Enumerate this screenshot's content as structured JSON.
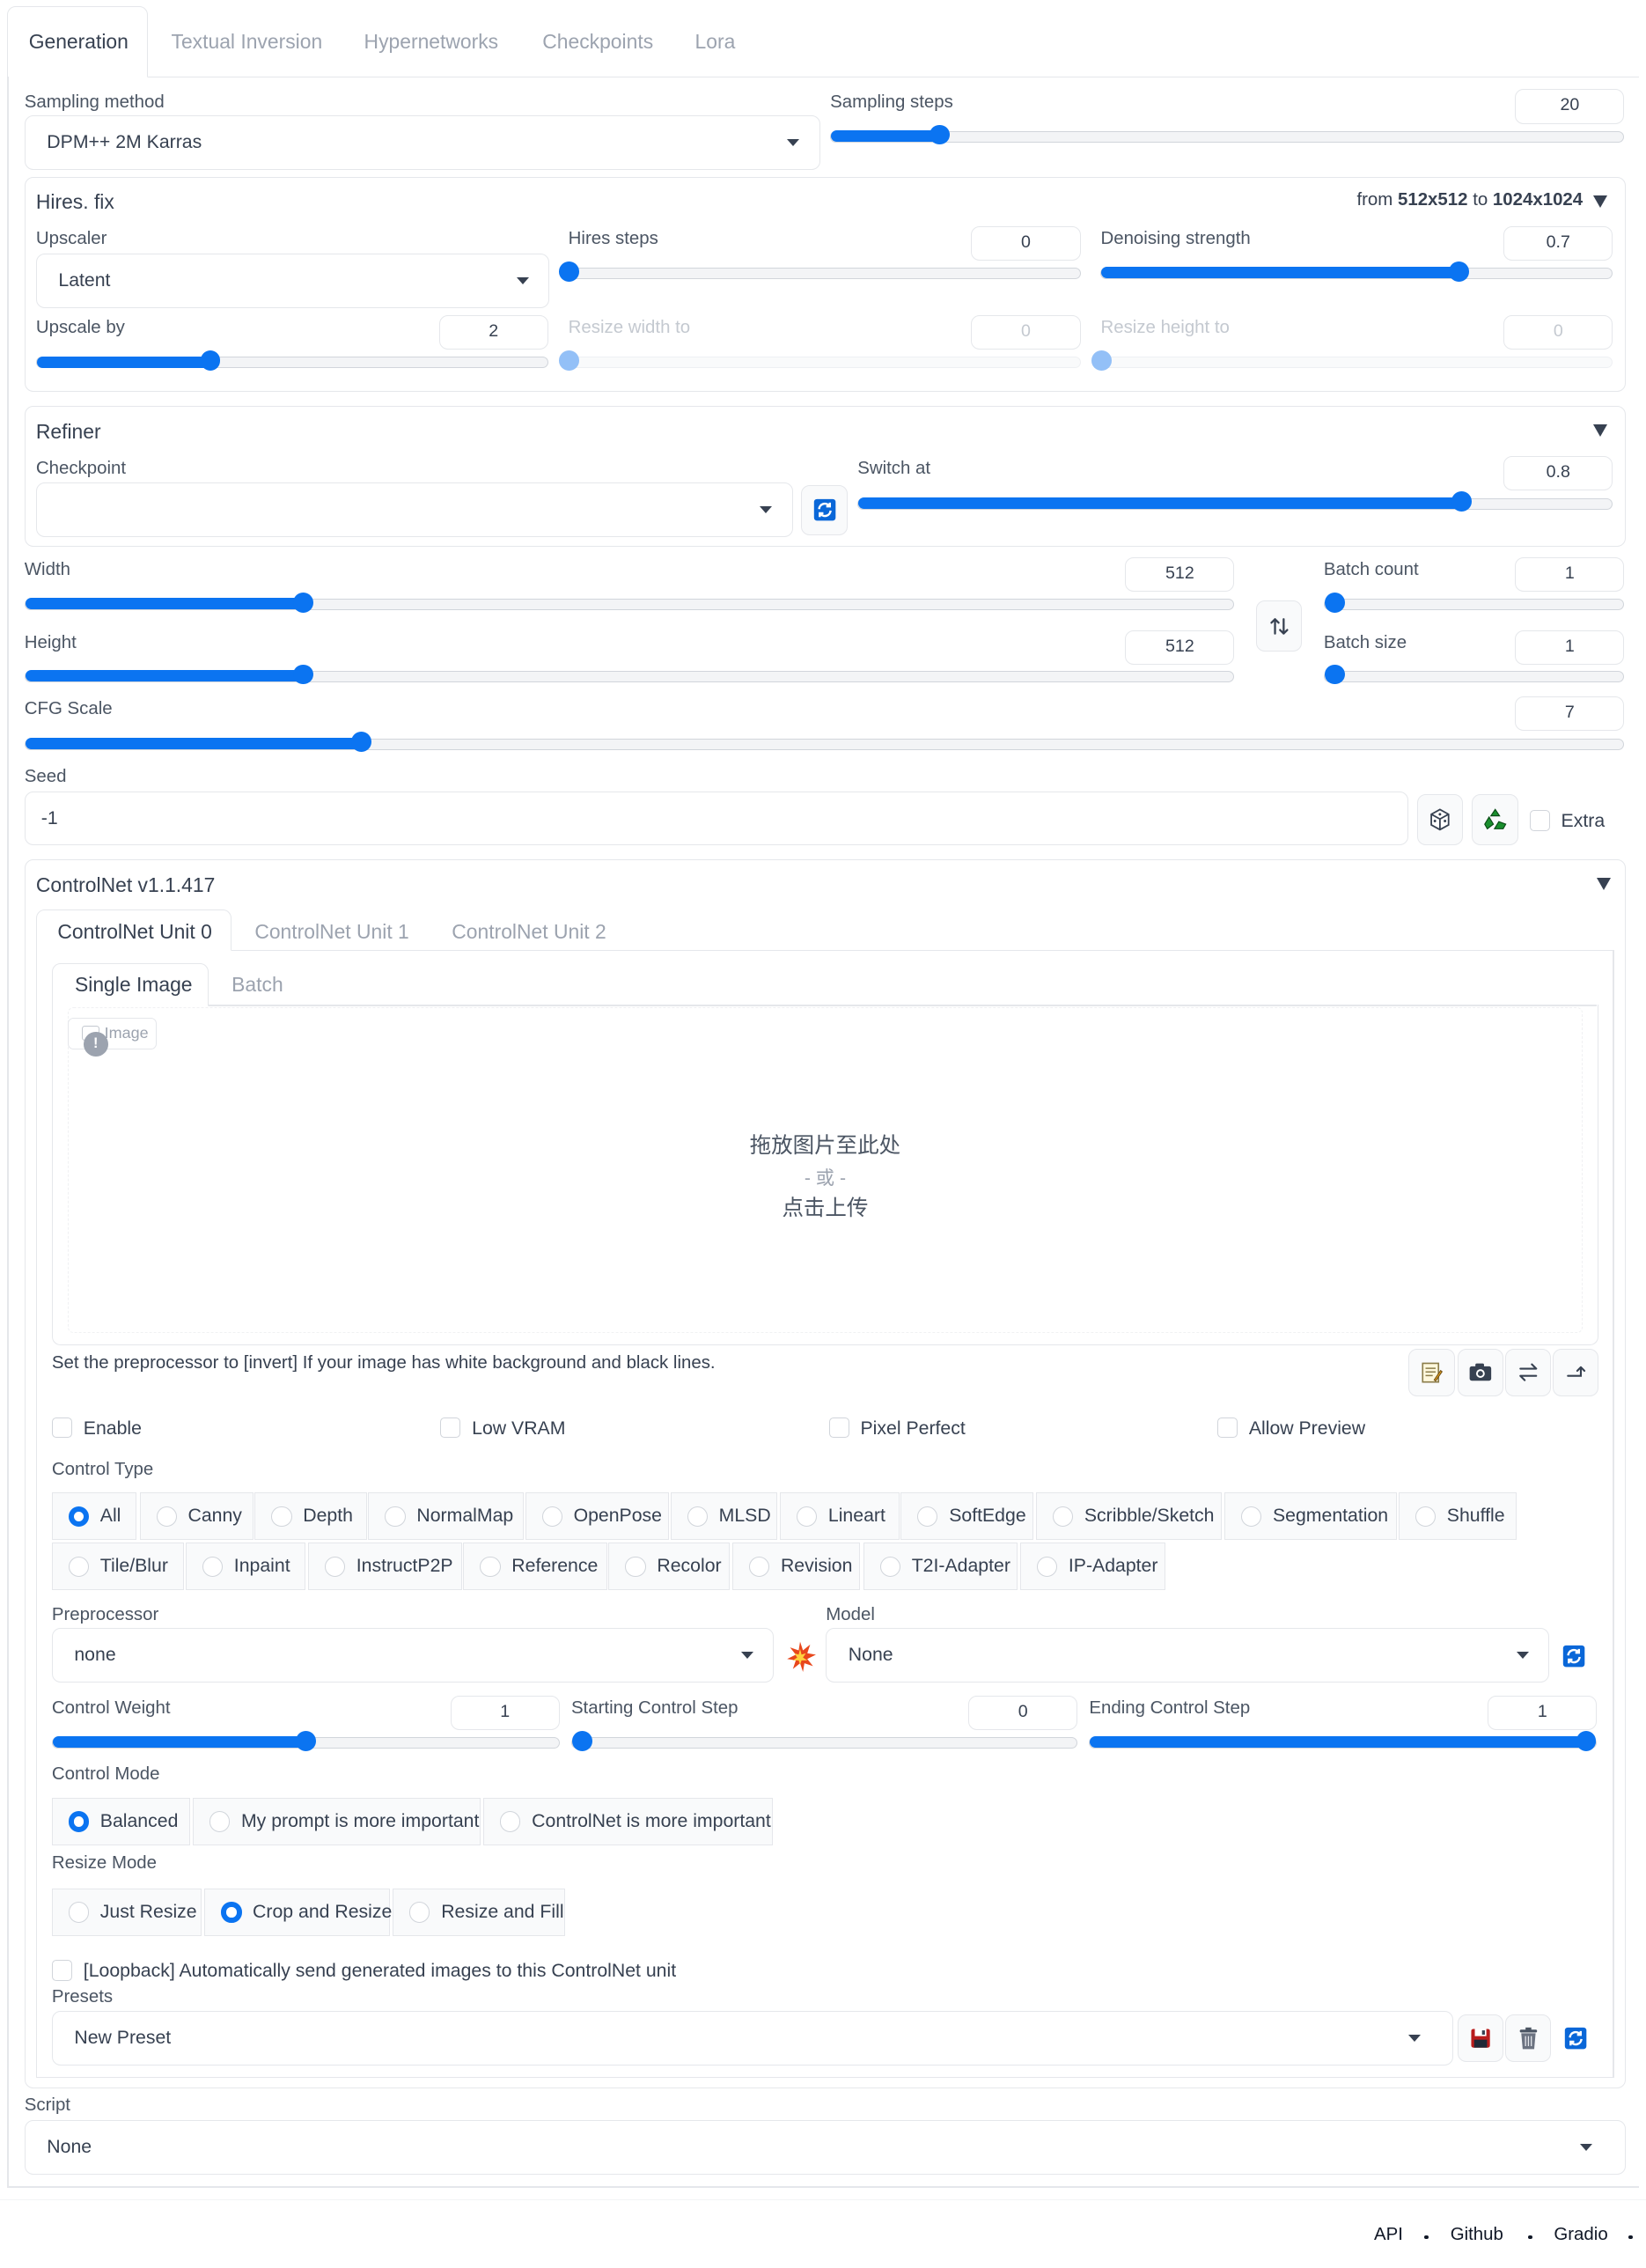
{
  "tabs": [
    "Generation",
    "Textual Inversion",
    "Hypernetworks",
    "Checkpoints",
    "Lora"
  ],
  "sampling_method": {
    "label": "Sampling method",
    "value": "DPM++ 2M Karras"
  },
  "sampling_steps": {
    "label": "Sampling steps",
    "value": "20",
    "fraction": 0.137
  },
  "hires": {
    "title": "Hires. fix",
    "from_word": "from",
    "from_res": "512x512",
    "to_word": "to",
    "to_res": "1024x1024",
    "upscaler_label": "Upscaler",
    "upscaler_value": "Latent",
    "steps_label": "Hires steps",
    "steps_value": "0",
    "steps_fraction": 0.0,
    "denoise_label": "Denoising strength",
    "denoise_value": "0.7",
    "denoise_fraction": 0.7,
    "upscale_label": "Upscale by",
    "upscale_value": "2",
    "upscale_fraction": 0.34,
    "rw_label": "Resize width to",
    "rw_value": "0",
    "rh_label": "Resize height to",
    "rh_value": "0"
  },
  "refiner": {
    "title": "Refiner",
    "checkpoint_label": "Checkpoint",
    "checkpoint_value": "",
    "switch_label": "Switch at",
    "switch_value": "0.8",
    "switch_fraction": 0.8
  },
  "width": {
    "label": "Width",
    "value": "512",
    "fraction": 0.23
  },
  "height": {
    "label": "Height",
    "value": "512",
    "fraction": 0.23
  },
  "batch_count": {
    "label": "Batch count",
    "value": "1",
    "fraction": 0.0
  },
  "batch_size": {
    "label": "Batch size",
    "value": "1",
    "fraction": 0.0
  },
  "cfg": {
    "label": "CFG Scale",
    "value": "7",
    "fraction": 0.21
  },
  "seed": {
    "label": "Seed",
    "value": "-1",
    "extra_label": "Extra"
  },
  "controlnet": {
    "title": "ControlNet v1.1.417",
    "units": [
      "ControlNet Unit 0",
      "ControlNet Unit 1",
      "ControlNet Unit 2"
    ],
    "image_tabs": [
      "Single Image",
      "Batch"
    ],
    "image_label": "Image",
    "drop_line1": "拖放图片至此处",
    "drop_line2": "- 或 -",
    "drop_line3": "点击上传",
    "hint": "Set the preprocessor to [invert] If your image has white background and black lines.",
    "checks": [
      "Enable",
      "Low VRAM",
      "Pixel Perfect",
      "Allow Preview"
    ],
    "control_type_label": "Control Type",
    "control_types_row1": [
      "All",
      "Canny",
      "Depth",
      "NormalMap",
      "OpenPose",
      "MLSD",
      "Lineart",
      "SoftEdge",
      "Scribble/Sketch",
      "Segmentation",
      "Shuffle"
    ],
    "control_types_row2": [
      "Tile/Blur",
      "Inpaint",
      "InstructP2P",
      "Reference",
      "Recolor",
      "Revision",
      "T2I-Adapter",
      "IP-Adapter"
    ],
    "preprocessor_label": "Preprocessor",
    "preprocessor_value": "none",
    "model_label": "Model",
    "model_value": "None",
    "weight_label": "Control Weight",
    "weight_value": "1",
    "weight_fraction": 0.5,
    "start_label": "Starting Control Step",
    "start_value": "0",
    "start_fraction": 0.0,
    "end_label": "Ending Control Step",
    "end_value": "1",
    "end_fraction": 1.0,
    "mode_label": "Control Mode",
    "modes": [
      "Balanced",
      "My prompt is more important",
      "ControlNet is more important"
    ],
    "resize_label": "Resize Mode",
    "resizes": [
      "Just Resize",
      "Crop and Resize",
      "Resize and Fill"
    ],
    "loopback": "[Loopback] Automatically send generated images to this ControlNet unit",
    "presets_label": "Presets",
    "presets_value": "New Preset"
  },
  "script": {
    "label": "Script",
    "value": "None"
  },
  "footer": [
    "API",
    "Github",
    "Gradio"
  ],
  "accent_color": "#0b74f1"
}
